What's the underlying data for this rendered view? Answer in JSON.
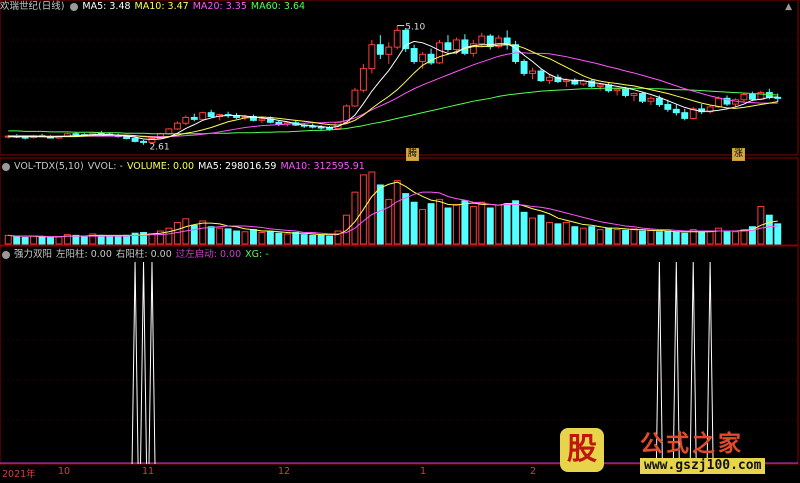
{
  "main_header": {
    "title": "欢瑞世纪(日线)",
    "ma5": "MA5: 3.48",
    "ma10": "MA10: 3.47",
    "ma20": "MA20: 3.35",
    "ma60": "MA60: 3.64"
  },
  "vol_header": {
    "title": "VOL-TDX(5,10)",
    "vvol": "VVOL: -",
    "volume": "VOLUME: 0.00",
    "ma5": "MA5: 298016.59",
    "ma10": "MA10: 312595.91"
  },
  "ind_header": {
    "title": "强力双阳",
    "left": "左阳柱: 0.00",
    "right": "右阳柱: 0.00",
    "guozuo": "过左启动: 0.00",
    "xg": "XG: -"
  },
  "annotations": {
    "high": "5.10",
    "low": "2.61",
    "tag1": "腾",
    "tag2": "涨"
  },
  "date_axis": [
    "2021年",
    "10",
    "11",
    "12",
    "1",
    "2"
  ],
  "logo": {
    "glyph": "股",
    "title": "公式之家",
    "url": "www.gszj100.com"
  },
  "colors": {
    "up": "#ff3c3c",
    "down": "#54ffff",
    "ma5": "#ffffff",
    "ma10": "#ffff55",
    "ma20": "#ff55ff",
    "ma60": "#55ff55",
    "grid": "#8b0000",
    "signal": "#ffffff"
  },
  "chart_data": [
    {
      "type": "candlestick",
      "title": "欢瑞世纪(日线)",
      "ylim": [
        2.5,
        5.3
      ],
      "series_names": [
        "MA5",
        "MA10",
        "MA20",
        "MA60"
      ],
      "ohlc": [
        [
          2.78,
          2.82,
          2.74,
          2.79
        ],
        [
          2.79,
          2.83,
          2.75,
          2.77
        ],
        [
          2.77,
          2.8,
          2.72,
          2.76
        ],
        [
          2.76,
          2.82,
          2.74,
          2.8
        ],
        [
          2.8,
          2.84,
          2.77,
          2.78
        ],
        [
          2.78,
          2.81,
          2.74,
          2.75
        ],
        [
          2.75,
          2.8,
          2.73,
          2.79
        ],
        [
          2.79,
          2.86,
          2.77,
          2.84
        ],
        [
          2.84,
          2.88,
          2.8,
          2.82
        ],
        [
          2.82,
          2.85,
          2.78,
          2.8
        ],
        [
          2.8,
          2.86,
          2.79,
          2.85
        ],
        [
          2.85,
          2.9,
          2.82,
          2.83
        ],
        [
          2.83,
          2.87,
          2.79,
          2.81
        ],
        [
          2.81,
          2.84,
          2.76,
          2.78
        ],
        [
          2.78,
          2.81,
          2.72,
          2.74
        ],
        [
          2.74,
          2.77,
          2.66,
          2.68
        ],
        [
          2.68,
          2.71,
          2.61,
          2.66
        ],
        [
          2.66,
          2.76,
          2.65,
          2.74
        ],
        [
          2.74,
          2.86,
          2.73,
          2.84
        ],
        [
          2.84,
          2.96,
          2.82,
          2.94
        ],
        [
          2.94,
          3.1,
          2.92,
          3.06
        ],
        [
          3.06,
          3.22,
          3.02,
          3.18
        ],
        [
          3.18,
          3.26,
          3.1,
          3.14
        ],
        [
          3.14,
          3.3,
          3.12,
          3.28
        ],
        [
          3.28,
          3.34,
          3.18,
          3.2
        ],
        [
          3.2,
          3.26,
          3.12,
          3.24
        ],
        [
          3.24,
          3.3,
          3.17,
          3.22
        ],
        [
          3.22,
          3.27,
          3.15,
          3.18
        ],
        [
          3.18,
          3.24,
          3.12,
          3.2
        ],
        [
          3.2,
          3.24,
          3.1,
          3.12
        ],
        [
          3.12,
          3.18,
          3.06,
          3.15
        ],
        [
          3.15,
          3.2,
          3.06,
          3.08
        ],
        [
          3.08,
          3.12,
          3.0,
          3.04
        ],
        [
          3.04,
          3.1,
          2.99,
          3.07
        ],
        [
          3.07,
          3.11,
          3.0,
          3.02
        ],
        [
          3.02,
          3.06,
          2.96,
          3.0
        ],
        [
          3.0,
          3.05,
          2.95,
          2.98
        ],
        [
          2.98,
          3.02,
          2.92,
          2.96
        ],
        [
          2.96,
          3.0,
          2.9,
          2.95
        ],
        [
          2.95,
          3.1,
          2.94,
          3.08
        ],
        [
          3.08,
          3.45,
          3.06,
          3.42
        ],
        [
          3.42,
          3.8,
          3.4,
          3.75
        ],
        [
          3.75,
          4.3,
          3.7,
          4.2
        ],
        [
          4.2,
          4.8,
          4.1,
          4.7
        ],
        [
          4.7,
          4.9,
          4.4,
          4.5
        ],
        [
          4.5,
          4.75,
          4.3,
          4.65
        ],
        [
          4.65,
          5.1,
          4.6,
          5.0
        ],
        [
          5.0,
          5.05,
          4.55,
          4.62
        ],
        [
          4.62,
          4.7,
          4.3,
          4.35
        ],
        [
          4.35,
          4.55,
          4.2,
          4.5
        ],
        [
          4.5,
          4.62,
          4.28,
          4.32
        ],
        [
          4.32,
          4.8,
          4.3,
          4.74
        ],
        [
          4.74,
          4.9,
          4.55,
          4.6
        ],
        [
          4.6,
          4.85,
          4.5,
          4.8
        ],
        [
          4.8,
          4.92,
          4.48,
          4.52
        ],
        [
          4.52,
          4.8,
          4.45,
          4.72
        ],
        [
          4.72,
          4.95,
          4.65,
          4.88
        ],
        [
          4.88,
          4.92,
          4.6,
          4.66
        ],
        [
          4.66,
          4.9,
          4.62,
          4.84
        ],
        [
          4.84,
          5.0,
          4.6,
          4.7
        ],
        [
          4.7,
          4.78,
          4.3,
          4.35
        ],
        [
          4.35,
          4.4,
          4.05,
          4.1
        ],
        [
          4.1,
          4.22,
          3.98,
          4.15
        ],
        [
          4.15,
          4.2,
          3.92,
          3.95
        ],
        [
          3.95,
          4.08,
          3.88,
          4.02
        ],
        [
          4.02,
          4.08,
          3.9,
          3.93
        ],
        [
          3.93,
          4.0,
          3.82,
          3.96
        ],
        [
          3.96,
          4.0,
          3.85,
          3.88
        ],
        [
          3.88,
          3.98,
          3.84,
          3.94
        ],
        [
          3.94,
          3.98,
          3.8,
          3.83
        ],
        [
          3.83,
          3.9,
          3.74,
          3.86
        ],
        [
          3.86,
          3.9,
          3.7,
          3.74
        ],
        [
          3.74,
          3.8,
          3.64,
          3.77
        ],
        [
          3.77,
          3.82,
          3.6,
          3.64
        ],
        [
          3.64,
          3.7,
          3.52,
          3.68
        ],
        [
          3.68,
          3.72,
          3.48,
          3.52
        ],
        [
          3.52,
          3.62,
          3.44,
          3.58
        ],
        [
          3.58,
          3.64,
          3.4,
          3.45
        ],
        [
          3.45,
          3.55,
          3.3,
          3.35
        ],
        [
          3.35,
          3.45,
          3.22,
          3.28
        ],
        [
          3.28,
          3.36,
          3.12,
          3.16
        ],
        [
          3.16,
          3.4,
          3.14,
          3.36
        ],
        [
          3.36,
          3.46,
          3.25,
          3.3
        ],
        [
          3.3,
          3.44,
          3.26,
          3.4
        ],
        [
          3.4,
          3.62,
          3.38,
          3.58
        ],
        [
          3.58,
          3.64,
          3.42,
          3.46
        ],
        [
          3.46,
          3.58,
          3.4,
          3.55
        ],
        [
          3.55,
          3.7,
          3.5,
          3.66
        ],
        [
          3.66,
          3.72,
          3.52,
          3.56
        ],
        [
          3.56,
          3.74,
          3.54,
          3.7
        ],
        [
          3.7,
          3.78,
          3.56,
          3.6
        ],
        [
          3.6,
          3.68,
          3.5,
          3.58
        ]
      ],
      "ma5": [
        2.78,
        2.78,
        2.78,
        2.78,
        2.78,
        2.77,
        2.78,
        2.79,
        2.8,
        2.81,
        2.82,
        2.83,
        2.82,
        2.81,
        2.79,
        2.77,
        2.73,
        2.72,
        2.73,
        2.77,
        2.85,
        2.95,
        3.03,
        3.12,
        3.17,
        3.21,
        3.22,
        3.22,
        3.21,
        3.19,
        3.17,
        3.15,
        3.12,
        3.09,
        3.05,
        3.02,
        3.01,
        2.99,
        2.97,
        2.99,
        3.08,
        3.23,
        3.47,
        3.73,
        3.95,
        4.16,
        4.42,
        4.69,
        4.77,
        4.74,
        4.67,
        4.58,
        4.52,
        4.53,
        4.64,
        4.68,
        4.7,
        4.7,
        4.72,
        4.72,
        4.63,
        4.48,
        4.35,
        4.2,
        4.08,
        4.0,
        3.97,
        3.95,
        3.95,
        3.91,
        3.89,
        3.86,
        3.83,
        3.8,
        3.76,
        3.71,
        3.66,
        3.6,
        3.53,
        3.46,
        3.39,
        3.34,
        3.31,
        3.31,
        3.33,
        3.36,
        3.4,
        3.46,
        3.54,
        3.56,
        3.6,
        3.61
      ],
      "ma10": [
        2.78,
        2.78,
        2.78,
        2.78,
        2.78,
        2.78,
        2.78,
        2.78,
        2.78,
        2.79,
        2.8,
        2.8,
        2.81,
        2.81,
        2.81,
        2.8,
        2.78,
        2.77,
        2.76,
        2.78,
        2.81,
        2.85,
        2.88,
        2.92,
        2.97,
        3.03,
        3.09,
        3.13,
        3.17,
        3.18,
        3.19,
        3.18,
        3.16,
        3.14,
        3.12,
        3.1,
        3.08,
        3.05,
        3.03,
        3.02,
        3.05,
        3.12,
        3.23,
        3.37,
        3.5,
        3.62,
        3.76,
        3.93,
        4.11,
        4.27,
        4.37,
        4.45,
        4.5,
        4.56,
        4.62,
        4.66,
        4.66,
        4.67,
        4.69,
        4.7,
        4.69,
        4.63,
        4.55,
        4.47,
        4.41,
        4.32,
        4.23,
        4.14,
        4.05,
        3.98,
        3.94,
        3.91,
        3.89,
        3.86,
        3.84,
        3.8,
        3.76,
        3.72,
        3.68,
        3.63,
        3.58,
        3.53,
        3.48,
        3.44,
        3.41,
        3.38,
        3.37,
        3.39,
        3.42,
        3.45,
        3.48,
        3.51
      ],
      "ma20": [
        2.8,
        2.8,
        2.8,
        2.8,
        2.79,
        2.79,
        2.79,
        2.79,
        2.79,
        2.79,
        2.79,
        2.79,
        2.79,
        2.79,
        2.79,
        2.79,
        2.79,
        2.78,
        2.78,
        2.78,
        2.79,
        2.8,
        2.81,
        2.83,
        2.85,
        2.88,
        2.91,
        2.94,
        2.97,
        2.99,
        3.01,
        3.02,
        3.03,
        3.04,
        3.05,
        3.06,
        3.07,
        3.07,
        3.08,
        3.08,
        3.12,
        3.17,
        3.25,
        3.34,
        3.42,
        3.5,
        3.59,
        3.69,
        3.78,
        3.86,
        3.93,
        4.0,
        4.07,
        4.14,
        4.21,
        4.28,
        4.34,
        4.4,
        4.46,
        4.5,
        4.53,
        4.53,
        4.52,
        4.52,
        4.51,
        4.48,
        4.45,
        4.41,
        4.37,
        4.33,
        4.29,
        4.24,
        4.2,
        4.15,
        4.11,
        4.06,
        4.01,
        3.96,
        3.9,
        3.84,
        3.78,
        3.73,
        3.68,
        3.63,
        3.59,
        3.55,
        3.52,
        3.5,
        3.49,
        3.48,
        3.48,
        3.48
      ],
      "ma60": [
        2.9,
        2.9,
        2.89,
        2.89,
        2.89,
        2.88,
        2.88,
        2.88,
        2.87,
        2.87,
        2.87,
        2.86,
        2.86,
        2.86,
        2.85,
        2.85,
        2.85,
        2.84,
        2.84,
        2.84,
        2.84,
        2.84,
        2.84,
        2.84,
        2.85,
        2.85,
        2.85,
        2.86,
        2.86,
        2.86,
        2.87,
        2.87,
        2.88,
        2.88,
        2.89,
        2.9,
        2.91,
        2.91,
        2.92,
        2.93,
        2.95,
        2.98,
        3.01,
        3.05,
        3.08,
        3.12,
        3.16,
        3.2,
        3.24,
        3.28,
        3.32,
        3.36,
        3.4,
        3.44,
        3.48,
        3.52,
        3.55,
        3.58,
        3.62,
        3.65,
        3.67,
        3.69,
        3.71,
        3.73,
        3.74,
        3.75,
        3.76,
        3.77,
        3.78,
        3.78,
        3.79,
        3.79,
        3.79,
        3.79,
        3.79,
        3.79,
        3.78,
        3.78,
        3.77,
        3.76,
        3.76,
        3.75,
        3.74,
        3.73,
        3.72,
        3.71,
        3.7,
        3.69,
        3.68,
        3.67,
        3.66,
        3.65
      ]
    },
    {
      "type": "bar",
      "title": "VOL-TDX(5,10)",
      "unit_scale": "relative 0-1",
      "volume": [
        0.12,
        0.1,
        0.09,
        0.11,
        0.1,
        0.09,
        0.1,
        0.13,
        0.12,
        0.11,
        0.14,
        0.12,
        0.11,
        0.1,
        0.12,
        0.15,
        0.16,
        0.14,
        0.18,
        0.22,
        0.3,
        0.35,
        0.26,
        0.32,
        0.24,
        0.22,
        0.21,
        0.18,
        0.17,
        0.2,
        0.16,
        0.17,
        0.15,
        0.14,
        0.16,
        0.13,
        0.12,
        0.12,
        0.11,
        0.18,
        0.4,
        0.72,
        0.96,
        1.0,
        0.82,
        0.62,
        0.88,
        0.7,
        0.58,
        0.48,
        0.56,
        0.62,
        0.5,
        0.55,
        0.6,
        0.52,
        0.58,
        0.5,
        0.54,
        0.56,
        0.6,
        0.44,
        0.36,
        0.4,
        0.3,
        0.28,
        0.3,
        0.24,
        0.22,
        0.24,
        0.2,
        0.22,
        0.2,
        0.19,
        0.21,
        0.18,
        0.19,
        0.17,
        0.18,
        0.16,
        0.15,
        0.2,
        0.16,
        0.18,
        0.22,
        0.18,
        0.17,
        0.2,
        0.24,
        0.52,
        0.4,
        0.28
      ],
      "ma5": [
        0.12,
        0.11,
        0.11,
        0.11,
        0.1,
        0.1,
        0.1,
        0.11,
        0.11,
        0.11,
        0.12,
        0.12,
        0.12,
        0.12,
        0.12,
        0.12,
        0.13,
        0.14,
        0.15,
        0.17,
        0.2,
        0.24,
        0.27,
        0.29,
        0.29,
        0.28,
        0.25,
        0.24,
        0.21,
        0.2,
        0.18,
        0.18,
        0.17,
        0.16,
        0.15,
        0.15,
        0.14,
        0.13,
        0.13,
        0.13,
        0.19,
        0.31,
        0.48,
        0.66,
        0.78,
        0.83,
        0.86,
        0.8,
        0.72,
        0.66,
        0.61,
        0.59,
        0.55,
        0.54,
        0.56,
        0.57,
        0.55,
        0.55,
        0.54,
        0.56,
        0.56,
        0.53,
        0.49,
        0.46,
        0.42,
        0.36,
        0.33,
        0.3,
        0.27,
        0.26,
        0.24,
        0.22,
        0.22,
        0.21,
        0.2,
        0.2,
        0.19,
        0.19,
        0.18,
        0.17,
        0.17,
        0.17,
        0.17,
        0.17,
        0.18,
        0.18,
        0.18,
        0.19,
        0.2,
        0.26,
        0.3,
        0.32
      ],
      "ma10": [
        0.12,
        0.11,
        0.11,
        0.11,
        0.11,
        0.1,
        0.1,
        0.11,
        0.11,
        0.11,
        0.11,
        0.11,
        0.11,
        0.11,
        0.11,
        0.12,
        0.12,
        0.13,
        0.13,
        0.14,
        0.16,
        0.18,
        0.2,
        0.22,
        0.23,
        0.24,
        0.25,
        0.25,
        0.25,
        0.24,
        0.23,
        0.21,
        0.2,
        0.19,
        0.18,
        0.16,
        0.16,
        0.15,
        0.14,
        0.14,
        0.16,
        0.22,
        0.32,
        0.41,
        0.46,
        0.51,
        0.59,
        0.64,
        0.69,
        0.72,
        0.72,
        0.71,
        0.66,
        0.63,
        0.61,
        0.58,
        0.57,
        0.55,
        0.54,
        0.55,
        0.55,
        0.54,
        0.52,
        0.51,
        0.49,
        0.46,
        0.43,
        0.4,
        0.37,
        0.34,
        0.31,
        0.29,
        0.27,
        0.25,
        0.24,
        0.22,
        0.21,
        0.2,
        0.2,
        0.19,
        0.18,
        0.18,
        0.18,
        0.18,
        0.18,
        0.18,
        0.18,
        0.18,
        0.19,
        0.22,
        0.24,
        0.25
      ]
    },
    {
      "type": "line",
      "title": "强力双阳",
      "signals_at_index": [
        15,
        16,
        17,
        77,
        79,
        81,
        83
      ],
      "ylim": [
        0,
        1
      ]
    }
  ]
}
